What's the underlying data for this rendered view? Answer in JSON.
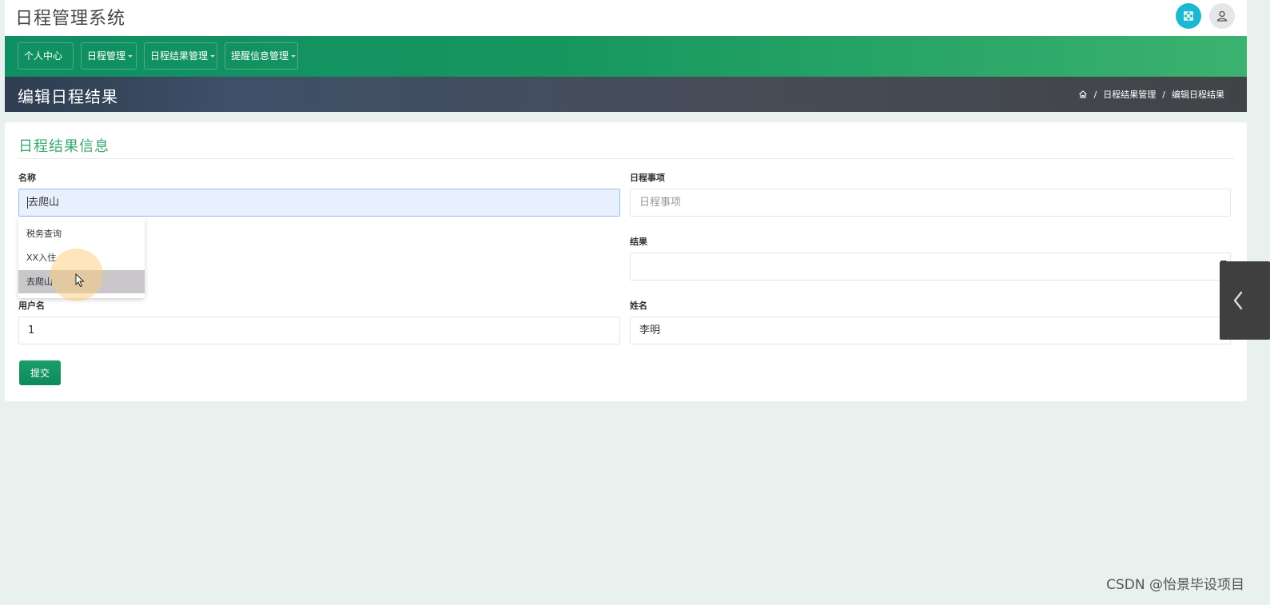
{
  "app": {
    "title": "日程管理系统"
  },
  "header": {
    "fullscreen_icon": "expand-arrows-icon",
    "user_icon": "user-icon",
    "accent_color": "#1bb8d2"
  },
  "nav": {
    "items": [
      {
        "label": "个人中心",
        "has_dropdown": false
      },
      {
        "label": "日程管理",
        "has_dropdown": true
      },
      {
        "label": "日程结果管理",
        "has_dropdown": true
      },
      {
        "label": "提醒信息管理",
        "has_dropdown": true
      }
    ],
    "color": "#16975f"
  },
  "page": {
    "title": "编辑日程结果",
    "breadcrumb": {
      "home_icon": "home-icon",
      "items": [
        "日程结果管理",
        "编辑日程结果"
      ],
      "separator": "/"
    }
  },
  "form": {
    "title": "日程结果信息",
    "title_color": "#3aa874",
    "fields": {
      "name": {
        "label": "名称",
        "value": "去爬山"
      },
      "schedule_item": {
        "label": "日程事项",
        "value": "",
        "placeholder": "日程事项"
      },
      "result": {
        "label": "结果",
        "value": ""
      },
      "username": {
        "label": "用户名",
        "value": "1"
      },
      "full_name": {
        "label": "姓名",
        "value": "李明"
      }
    },
    "autocomplete_options": [
      "税务查询",
      "XX入住",
      "去爬山"
    ],
    "hovered_option": "去爬山",
    "submit_label": "提交"
  },
  "watermark": "CSDN @怡景毕设项目"
}
